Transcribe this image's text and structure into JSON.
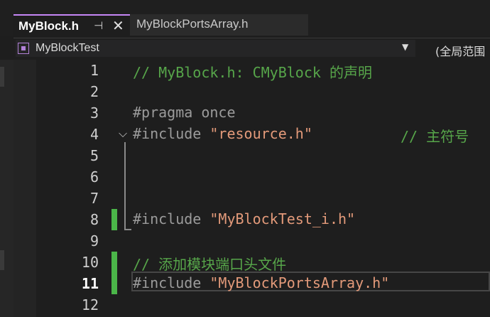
{
  "tabs": [
    {
      "label": "MyBlock.h",
      "active": true,
      "pinned": true
    },
    {
      "label": "MyBlockPortsArray.h",
      "active": false
    }
  ],
  "navbar": {
    "class_selector": "MyBlockTest",
    "scope_selector": "(全局范围"
  },
  "editor": {
    "current_line": 11,
    "lines": [
      {
        "number": "1",
        "tokens": [
          {
            "t": "// MyBlock.h: CMyBlock 的声明",
            "k": "comment"
          }
        ]
      },
      {
        "number": "2",
        "tokens": []
      },
      {
        "number": "3",
        "tokens": [
          {
            "t": "#pragma once",
            "k": "pre"
          }
        ]
      },
      {
        "number": "4",
        "tokens": [
          {
            "t": "#include ",
            "k": "pre"
          },
          {
            "t": "\"resource.h\"",
            "k": "str"
          }
        ],
        "inline_comment": "// 主符号"
      },
      {
        "number": "5",
        "tokens": []
      },
      {
        "number": "6",
        "tokens": []
      },
      {
        "number": "7",
        "tokens": []
      },
      {
        "number": "8",
        "tokens": [
          {
            "t": "#include ",
            "k": "pre"
          },
          {
            "t": "\"MyBlockTest_i.h\"",
            "k": "str"
          }
        ]
      },
      {
        "number": "9",
        "tokens": []
      },
      {
        "number": "10",
        "tokens": [
          {
            "t": "// 添加模块端口头文件",
            "k": "comment"
          }
        ]
      },
      {
        "number": "11",
        "tokens": [
          {
            "t": "#include ",
            "k": "pre"
          },
          {
            "t": "\"MyBlockPortsArray.h\"",
            "k": "str"
          }
        ]
      },
      {
        "number": "12",
        "tokens": []
      }
    ]
  },
  "colors": {
    "comment": "#57a64a",
    "preprocessor": "#9b9b9b",
    "string": "#e39a7a",
    "change_marker": "#4bb649",
    "active_tab_accent": "#c586f5"
  },
  "icons": {
    "pin": "pin-icon",
    "close": "close-icon",
    "class": "class-icon",
    "dropdown": "chevron-down-icon",
    "fold": "chevron-down-icon"
  }
}
